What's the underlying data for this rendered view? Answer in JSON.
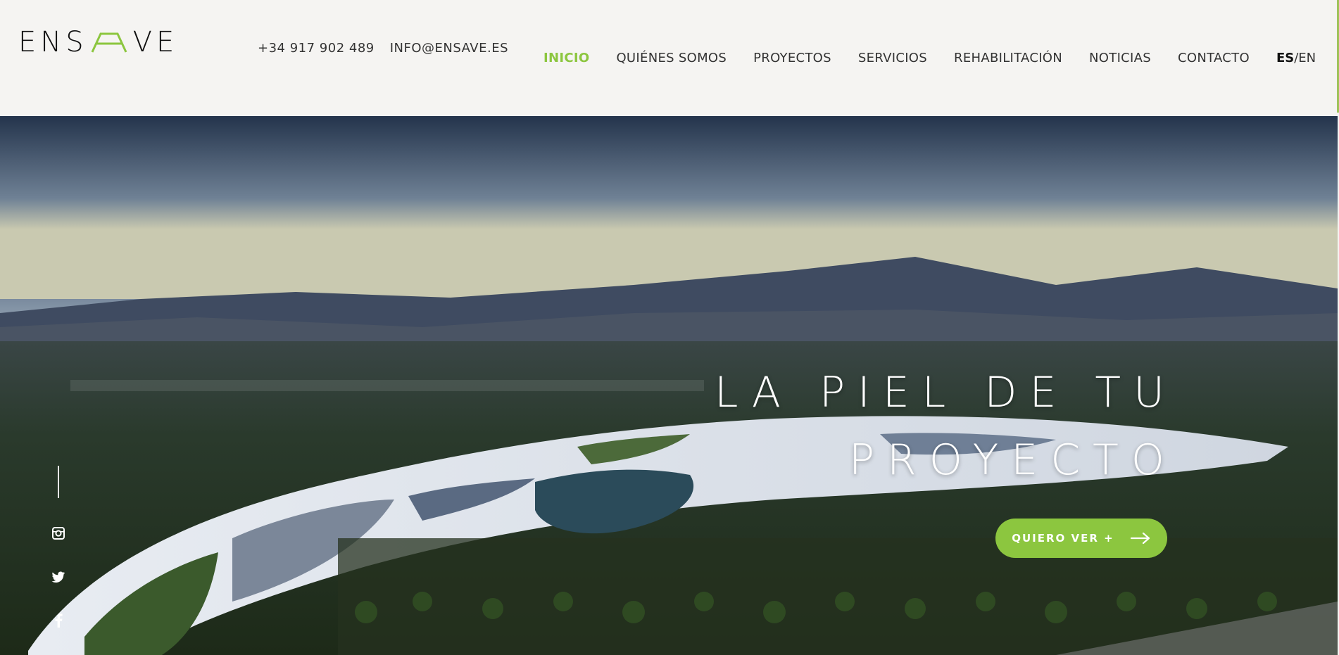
{
  "brand": {
    "logo_text_left": "ENS",
    "logo_text_right": "VE",
    "accent": "#8cc63f"
  },
  "contact": {
    "phone": "+34 917 902 489",
    "email": "INFO@ENSAVE.ES"
  },
  "nav": {
    "items": [
      {
        "label": "INICIO",
        "active": true
      },
      {
        "label": "QUIÉNES SOMOS"
      },
      {
        "label": "PROYECTOS"
      },
      {
        "label": "SERVICIOS"
      },
      {
        "label": "REHABILITACIÓN"
      },
      {
        "label": "NOTICIAS"
      },
      {
        "label": "CONTACTO"
      }
    ],
    "lang_active": "ES",
    "lang_sep": "/",
    "lang_other": "EN"
  },
  "hero": {
    "title_line1": "LA PIEL DE TU",
    "title_line2": "PROYECTO",
    "cta_label": "QUIERO VER +"
  },
  "social": {
    "icons": [
      "instagram-icon",
      "twitter-icon",
      "facebook-icon"
    ]
  }
}
